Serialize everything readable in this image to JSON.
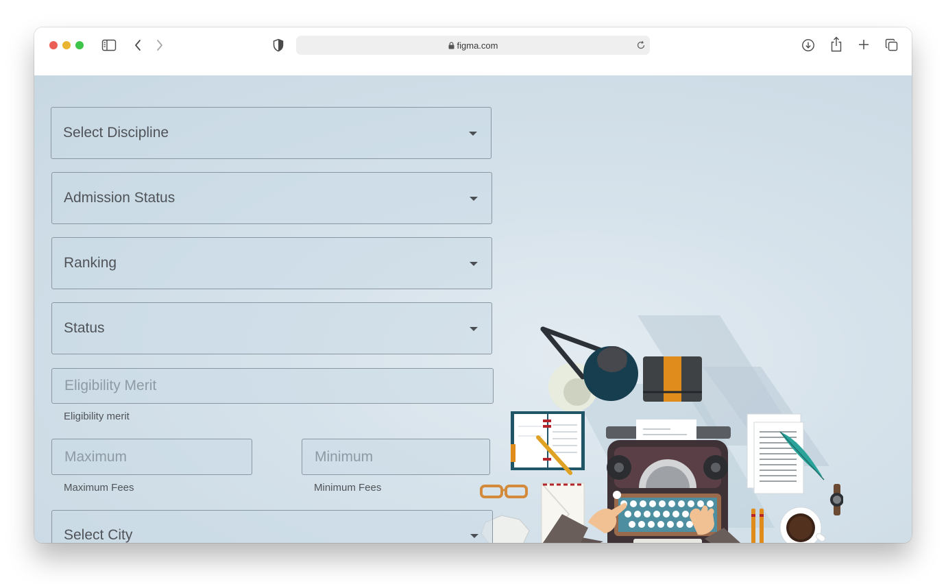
{
  "browser": {
    "url": "figma.com",
    "icons": [
      "sidebar-icon",
      "back-icon",
      "forward-icon",
      "shield-icon",
      "lock-icon",
      "reload-icon",
      "download-icon",
      "share-icon",
      "new-tab-icon",
      "tabs-overview-icon"
    ]
  },
  "form": {
    "discipline": {
      "label": "Select Discipline"
    },
    "admission_status": {
      "label": "Admission Status"
    },
    "ranking": {
      "label": "Ranking"
    },
    "status": {
      "label": "Status"
    },
    "eligibility": {
      "placeholder": "Eligibility Merit",
      "helper": "Eligibility merit"
    },
    "max_fees": {
      "placeholder": "Maximum",
      "helper": "Maximum Fees"
    },
    "min_fees": {
      "placeholder": "Minimum",
      "helper": "Minimum Fees"
    },
    "city": {
      "label": "Select City"
    }
  },
  "colors": {
    "background": "#cbdae5",
    "field_border": "#8a97a3",
    "label_text": "#4f5358",
    "placeholder_text": "#8e9aa4"
  }
}
